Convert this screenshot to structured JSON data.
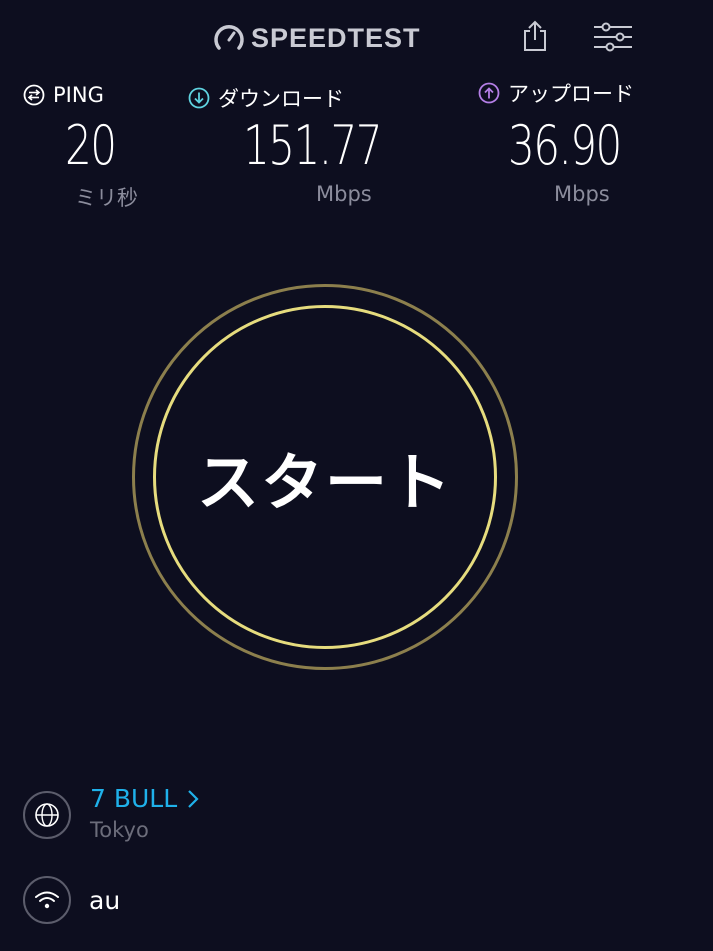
{
  "header": {
    "logo_text": "SPEEDTEST",
    "icons": {
      "logo": "speedometer-icon",
      "share": "share-icon",
      "settings": "sliders-icon"
    }
  },
  "metrics": {
    "ping": {
      "label": "PING",
      "value": "20",
      "unit": "ミリ秒",
      "icon": "ping-icon",
      "color": "#ffffff"
    },
    "download": {
      "label": "ダウンロード",
      "value": "151.77",
      "unit": "Mbps",
      "icon": "download-arrow-icon",
      "color": "#5fd3e0"
    },
    "upload": {
      "label": "アップロード",
      "value": "36.90",
      "unit": "Mbps",
      "icon": "upload-arrow-icon",
      "color": "#b47ee6"
    }
  },
  "start_button": {
    "label": "スタート"
  },
  "server": {
    "name": "7 BULL",
    "location": "Tokyo",
    "icon": "globe-icon"
  },
  "provider": {
    "name": "au",
    "icon": "wifi-icon"
  },
  "colors": {
    "background": "#0d0e1f",
    "accent_link": "#1fb1ea",
    "ring_outer": "#8c7f4d",
    "ring_inner": "#e6dc7e"
  }
}
